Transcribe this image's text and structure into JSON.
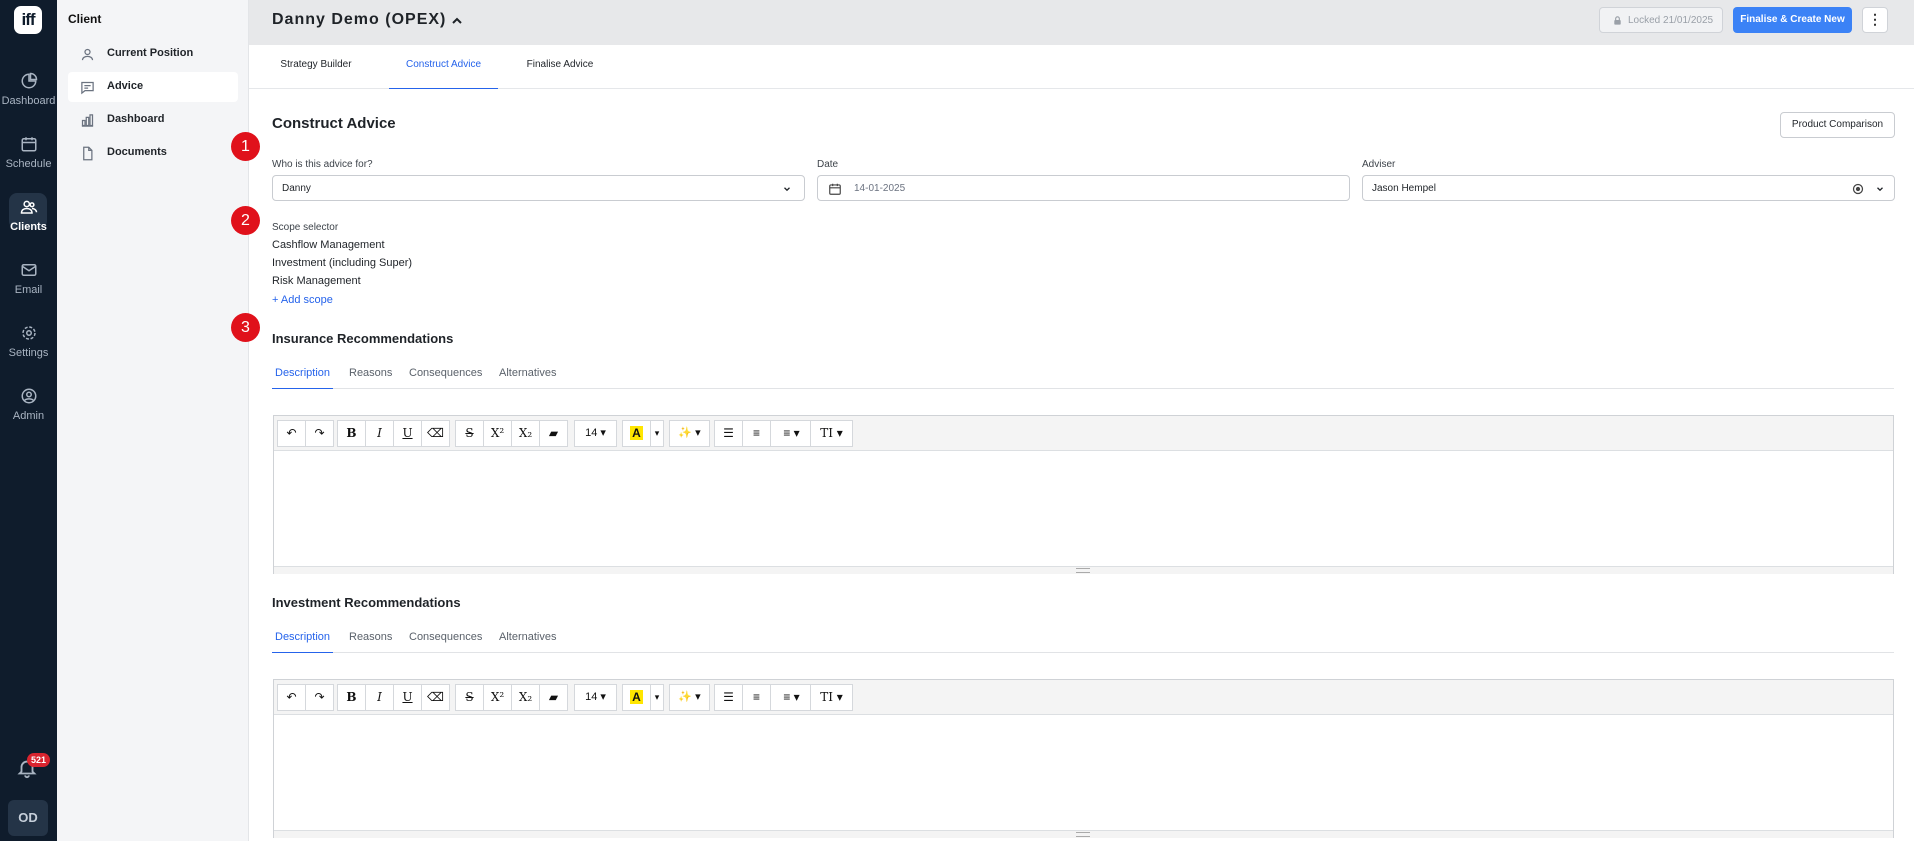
{
  "app": {
    "logo_text": "iff"
  },
  "rail": {
    "items": [
      {
        "label": "Dashboard",
        "icon": "pie-chart-icon"
      },
      {
        "label": "Schedule",
        "icon": "calendar-icon"
      },
      {
        "label": "Clients",
        "icon": "users-icon",
        "active": true
      },
      {
        "label": "Email",
        "icon": "mail-icon"
      },
      {
        "label": "Settings",
        "icon": "gear-icon"
      },
      {
        "label": "Admin",
        "icon": "user-circle-icon"
      }
    ],
    "notifications_count": "521",
    "avatar_initials": "OD"
  },
  "sidebar": {
    "title": "Client",
    "items": [
      {
        "label": "Current Position",
        "icon": "person-icon"
      },
      {
        "label": "Advice",
        "icon": "chat-icon",
        "active": true
      },
      {
        "label": "Dashboard",
        "icon": "bar-chart-icon"
      },
      {
        "label": "Documents",
        "icon": "document-icon"
      }
    ]
  },
  "header": {
    "client_name": "Danny Demo (OPEX)",
    "locked_label": "Locked 21/01/2025",
    "finalise_label": "Finalise & Create New",
    "more_label": "⋮"
  },
  "tabs": {
    "items": [
      {
        "label": "Strategy Builder"
      },
      {
        "label": "Construct Advice",
        "active": true
      },
      {
        "label": "Finalise Advice"
      }
    ]
  },
  "construct": {
    "title": "Construct Advice",
    "product_comparison_label": "Product Comparison",
    "steps": [
      "1",
      "2",
      "3"
    ],
    "who_label": "Who is this advice for?",
    "who_value": "Danny",
    "date_label": "Date",
    "date_value": "14-01-2025",
    "adviser_label": "Adviser",
    "adviser_value": "Jason Hempel",
    "scope_label": "Scope selector",
    "scopes": [
      "Cashflow Management",
      "Investment (including Super)",
      "Risk Management"
    ],
    "add_scope_label": "+ Add scope"
  },
  "recommendations": [
    {
      "title": "Insurance Recommendations",
      "tabs": [
        "Description",
        "Reasons",
        "Consequences",
        "Alternatives"
      ],
      "font_size": "14"
    },
    {
      "title": "Investment Recommendations",
      "tabs": [
        "Description",
        "Reasons",
        "Consequences",
        "Alternatives"
      ],
      "font_size": "14"
    }
  ],
  "colors": {
    "accent": "#3b82f6",
    "rail_bg": "#0f1c2c",
    "step_badge": "#e0111b",
    "link": "#2563eb"
  }
}
